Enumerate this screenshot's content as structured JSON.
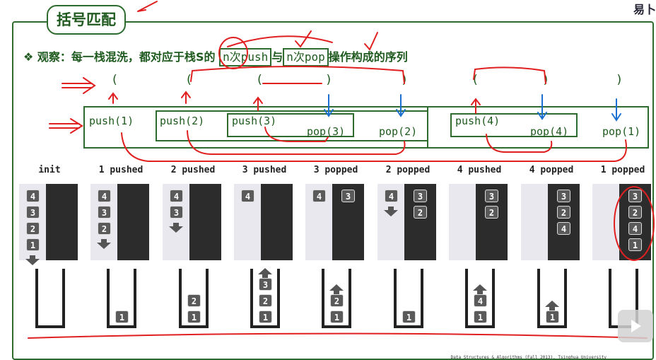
{
  "title": "括号匹配",
  "observation": {
    "bullet": "❖",
    "prefix": "观察：每一栈混洗，都对应于栈",
    "stack_name": "S",
    "mid1": "的",
    "push_box": "n次push",
    "mid2": "与",
    "pop_box": "n次pop",
    "suffix": "操作构成的序列"
  },
  "parens": [
    "(",
    "(",
    "(",
    ")",
    ")",
    "(",
    ")",
    ")"
  ],
  "ops": [
    "push(1)",
    "push(2)",
    "push(3)",
    "pop(3)",
    "pop(2)",
    "push(4)",
    "pop(4)",
    "pop(1)"
  ],
  "steps": [
    {
      "label": "init",
      "light_badges": [
        "4",
        "3",
        "2",
        "1"
      ],
      "dark_badges": [],
      "stack": []
    },
    {
      "label": "1 pushed",
      "light_badges": [
        "4",
        "3",
        "2"
      ],
      "dark_badges": [],
      "stack": [
        "1"
      ]
    },
    {
      "label": "2 pushed",
      "light_badges": [
        "4",
        "3"
      ],
      "dark_badges": [],
      "stack": [
        "2",
        "1"
      ]
    },
    {
      "label": "3 pushed",
      "light_badges": [
        "4"
      ],
      "dark_badges": [],
      "stack": [
        "3",
        "2",
        "1"
      ]
    },
    {
      "label": "3 popped",
      "light_badges": [
        "4"
      ],
      "dark_badges": [
        "3"
      ],
      "stack": [
        "2",
        "1"
      ]
    },
    {
      "label": "2 popped",
      "light_badges": [
        "4"
      ],
      "dark_badges": [
        "3",
        "2"
      ],
      "stack": [
        "1"
      ]
    },
    {
      "label": "4 pushed",
      "light_badges": [],
      "dark_badges": [
        "3",
        "2"
      ],
      "stack": [
        "4",
        "1"
      ]
    },
    {
      "label": "4 popped",
      "light_badges": [],
      "dark_badges": [
        "3",
        "2",
        "4"
      ],
      "stack": [
        "1"
      ]
    },
    {
      "label": "1 popped",
      "light_badges": [],
      "dark_badges": [
        "3",
        "2",
        "4",
        "1"
      ],
      "stack": []
    }
  ],
  "footer": "Data Structures & Algorithms (Fall 2013), Tsinghua University",
  "corner_text": "易卜",
  "colors": {
    "accent": "#2e6b2e",
    "ink_red": "#e02020",
    "ink_blue": "#1a6fd0"
  }
}
